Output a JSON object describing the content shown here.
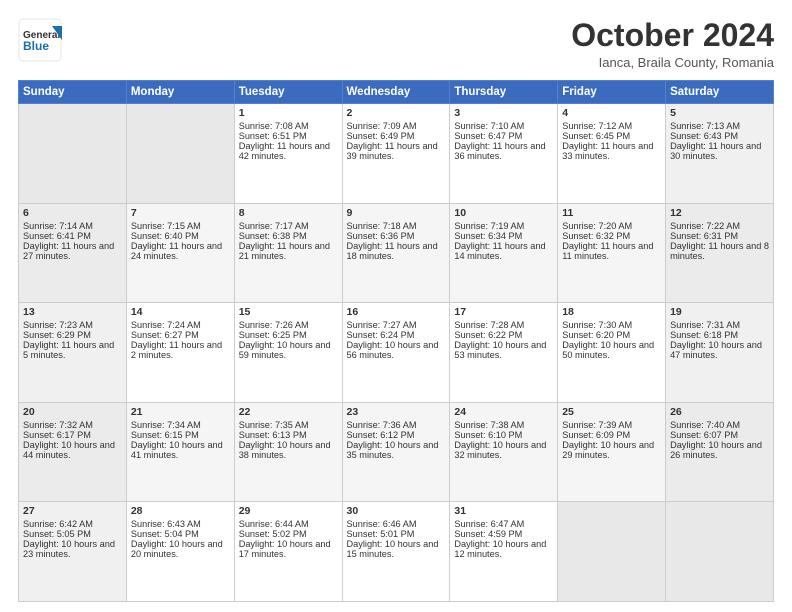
{
  "header": {
    "logo_line1": "General",
    "logo_line2": "Blue",
    "month_title": "October 2024",
    "location": "Ianca, Braila County, Romania"
  },
  "days_of_week": [
    "Sunday",
    "Monday",
    "Tuesday",
    "Wednesday",
    "Thursday",
    "Friday",
    "Saturday"
  ],
  "weeks": [
    [
      {
        "day": "",
        "sunrise": "",
        "sunset": "",
        "daylight": "",
        "empty": true
      },
      {
        "day": "",
        "sunrise": "",
        "sunset": "",
        "daylight": "",
        "empty": true
      },
      {
        "day": "1",
        "sunrise": "Sunrise: 7:08 AM",
        "sunset": "Sunset: 6:51 PM",
        "daylight": "Daylight: 11 hours and 42 minutes."
      },
      {
        "day": "2",
        "sunrise": "Sunrise: 7:09 AM",
        "sunset": "Sunset: 6:49 PM",
        "daylight": "Daylight: 11 hours and 39 minutes."
      },
      {
        "day": "3",
        "sunrise": "Sunrise: 7:10 AM",
        "sunset": "Sunset: 6:47 PM",
        "daylight": "Daylight: 11 hours and 36 minutes."
      },
      {
        "day": "4",
        "sunrise": "Sunrise: 7:12 AM",
        "sunset": "Sunset: 6:45 PM",
        "daylight": "Daylight: 11 hours and 33 minutes."
      },
      {
        "day": "5",
        "sunrise": "Sunrise: 7:13 AM",
        "sunset": "Sunset: 6:43 PM",
        "daylight": "Daylight: 11 hours and 30 minutes."
      }
    ],
    [
      {
        "day": "6",
        "sunrise": "Sunrise: 7:14 AM",
        "sunset": "Sunset: 6:41 PM",
        "daylight": "Daylight: 11 hours and 27 minutes."
      },
      {
        "day": "7",
        "sunrise": "Sunrise: 7:15 AM",
        "sunset": "Sunset: 6:40 PM",
        "daylight": "Daylight: 11 hours and 24 minutes."
      },
      {
        "day": "8",
        "sunrise": "Sunrise: 7:17 AM",
        "sunset": "Sunset: 6:38 PM",
        "daylight": "Daylight: 11 hours and 21 minutes."
      },
      {
        "day": "9",
        "sunrise": "Sunrise: 7:18 AM",
        "sunset": "Sunset: 6:36 PM",
        "daylight": "Daylight: 11 hours and 18 minutes."
      },
      {
        "day": "10",
        "sunrise": "Sunrise: 7:19 AM",
        "sunset": "Sunset: 6:34 PM",
        "daylight": "Daylight: 11 hours and 14 minutes."
      },
      {
        "day": "11",
        "sunrise": "Sunrise: 7:20 AM",
        "sunset": "Sunset: 6:32 PM",
        "daylight": "Daylight: 11 hours and 11 minutes."
      },
      {
        "day": "12",
        "sunrise": "Sunrise: 7:22 AM",
        "sunset": "Sunset: 6:31 PM",
        "daylight": "Daylight: 11 hours and 8 minutes."
      }
    ],
    [
      {
        "day": "13",
        "sunrise": "Sunrise: 7:23 AM",
        "sunset": "Sunset: 6:29 PM",
        "daylight": "Daylight: 11 hours and 5 minutes."
      },
      {
        "day": "14",
        "sunrise": "Sunrise: 7:24 AM",
        "sunset": "Sunset: 6:27 PM",
        "daylight": "Daylight: 11 hours and 2 minutes."
      },
      {
        "day": "15",
        "sunrise": "Sunrise: 7:26 AM",
        "sunset": "Sunset: 6:25 PM",
        "daylight": "Daylight: 10 hours and 59 minutes."
      },
      {
        "day": "16",
        "sunrise": "Sunrise: 7:27 AM",
        "sunset": "Sunset: 6:24 PM",
        "daylight": "Daylight: 10 hours and 56 minutes."
      },
      {
        "day": "17",
        "sunrise": "Sunrise: 7:28 AM",
        "sunset": "Sunset: 6:22 PM",
        "daylight": "Daylight: 10 hours and 53 minutes."
      },
      {
        "day": "18",
        "sunrise": "Sunrise: 7:30 AM",
        "sunset": "Sunset: 6:20 PM",
        "daylight": "Daylight: 10 hours and 50 minutes."
      },
      {
        "day": "19",
        "sunrise": "Sunrise: 7:31 AM",
        "sunset": "Sunset: 6:18 PM",
        "daylight": "Daylight: 10 hours and 47 minutes."
      }
    ],
    [
      {
        "day": "20",
        "sunrise": "Sunrise: 7:32 AM",
        "sunset": "Sunset: 6:17 PM",
        "daylight": "Daylight: 10 hours and 44 minutes."
      },
      {
        "day": "21",
        "sunrise": "Sunrise: 7:34 AM",
        "sunset": "Sunset: 6:15 PM",
        "daylight": "Daylight: 10 hours and 41 minutes."
      },
      {
        "day": "22",
        "sunrise": "Sunrise: 7:35 AM",
        "sunset": "Sunset: 6:13 PM",
        "daylight": "Daylight: 10 hours and 38 minutes."
      },
      {
        "day": "23",
        "sunrise": "Sunrise: 7:36 AM",
        "sunset": "Sunset: 6:12 PM",
        "daylight": "Daylight: 10 hours and 35 minutes."
      },
      {
        "day": "24",
        "sunrise": "Sunrise: 7:38 AM",
        "sunset": "Sunset: 6:10 PM",
        "daylight": "Daylight: 10 hours and 32 minutes."
      },
      {
        "day": "25",
        "sunrise": "Sunrise: 7:39 AM",
        "sunset": "Sunset: 6:09 PM",
        "daylight": "Daylight: 10 hours and 29 minutes."
      },
      {
        "day": "26",
        "sunrise": "Sunrise: 7:40 AM",
        "sunset": "Sunset: 6:07 PM",
        "daylight": "Daylight: 10 hours and 26 minutes."
      }
    ],
    [
      {
        "day": "27",
        "sunrise": "Sunrise: 6:42 AM",
        "sunset": "Sunset: 5:05 PM",
        "daylight": "Daylight: 10 hours and 23 minutes."
      },
      {
        "day": "28",
        "sunrise": "Sunrise: 6:43 AM",
        "sunset": "Sunset: 5:04 PM",
        "daylight": "Daylight: 10 hours and 20 minutes."
      },
      {
        "day": "29",
        "sunrise": "Sunrise: 6:44 AM",
        "sunset": "Sunset: 5:02 PM",
        "daylight": "Daylight: 10 hours and 17 minutes."
      },
      {
        "day": "30",
        "sunrise": "Sunrise: 6:46 AM",
        "sunset": "Sunset: 5:01 PM",
        "daylight": "Daylight: 10 hours and 15 minutes."
      },
      {
        "day": "31",
        "sunrise": "Sunrise: 6:47 AM",
        "sunset": "Sunset: 4:59 PM",
        "daylight": "Daylight: 10 hours and 12 minutes."
      },
      {
        "day": "",
        "sunrise": "",
        "sunset": "",
        "daylight": "",
        "empty": true
      },
      {
        "day": "",
        "sunrise": "",
        "sunset": "",
        "daylight": "",
        "empty": true
      }
    ]
  ]
}
